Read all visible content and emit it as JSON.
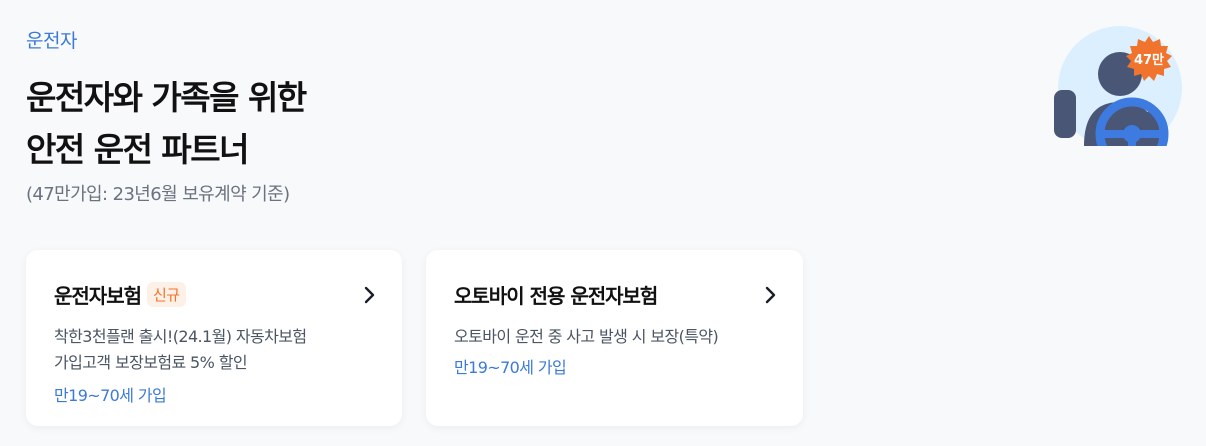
{
  "section": {
    "category": "운전자"
  },
  "headline": {
    "line1": "운전자와 가족을 위한",
    "line2": "안전 운전 파트너"
  },
  "subnote": "(47만가입: 23년6월 보유계약 기준)",
  "hero": {
    "badge_text": "47만",
    "icon": "driver-steering-wheel-illustration"
  },
  "cards": [
    {
      "title": "운전자보험",
      "badge": "신규",
      "desc_line1": "착한3천플랜 출시!(24.1월) 자동차보험",
      "desc_line2": "가입고객 보장보험료 5% 할인",
      "age": "만19~70세 가입",
      "icon": "chevron-right-icon"
    },
    {
      "title": "오토바이 전용 운전자보험",
      "desc_line1": "오토바이 운전 중 사고 발생 시 보장(특약)",
      "age": "만19~70세 가입",
      "icon": "chevron-right-icon"
    }
  ],
  "colors": {
    "accent": "#3b7ad9",
    "badge_orange": "#f0742d",
    "badge_bg": "#fdf1e7",
    "hero_circle": "#dcefff",
    "figure": "#4a5675"
  }
}
